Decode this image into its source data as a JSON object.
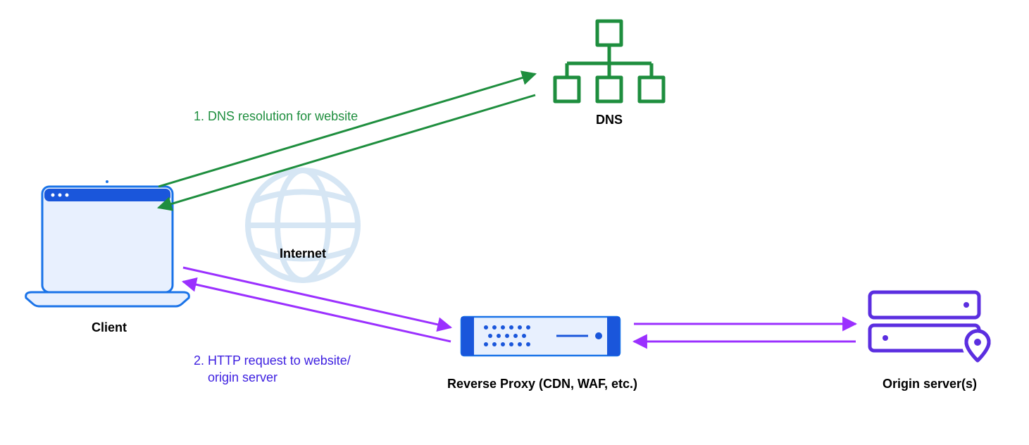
{
  "nodes": {
    "client": {
      "label": "Client"
    },
    "internet": {
      "label": "Internet"
    },
    "dns": {
      "label": "DNS"
    },
    "proxy": {
      "label": "Reverse Proxy (CDN, WAF, etc.)"
    },
    "origin": {
      "label": "Origin server(s)"
    }
  },
  "steps": {
    "dns_resolution": {
      "text": "1. DNS resolution for website",
      "color": "#1E8E3E"
    },
    "http_request": {
      "text_line1": "2. HTTP request to website/",
      "text_line2": "origin server",
      "color": "#3C1EE0"
    }
  },
  "colors": {
    "green": "#1E8E3E",
    "purple": "#9B30FF",
    "indigo": "#3C1EE0",
    "blue_outline": "#1A73E8",
    "blue_fill": "#E8F0FE",
    "blue_accent": "#1A56DB",
    "globe": "#CFE2F3",
    "server_purple": "#5B2EE0"
  }
}
